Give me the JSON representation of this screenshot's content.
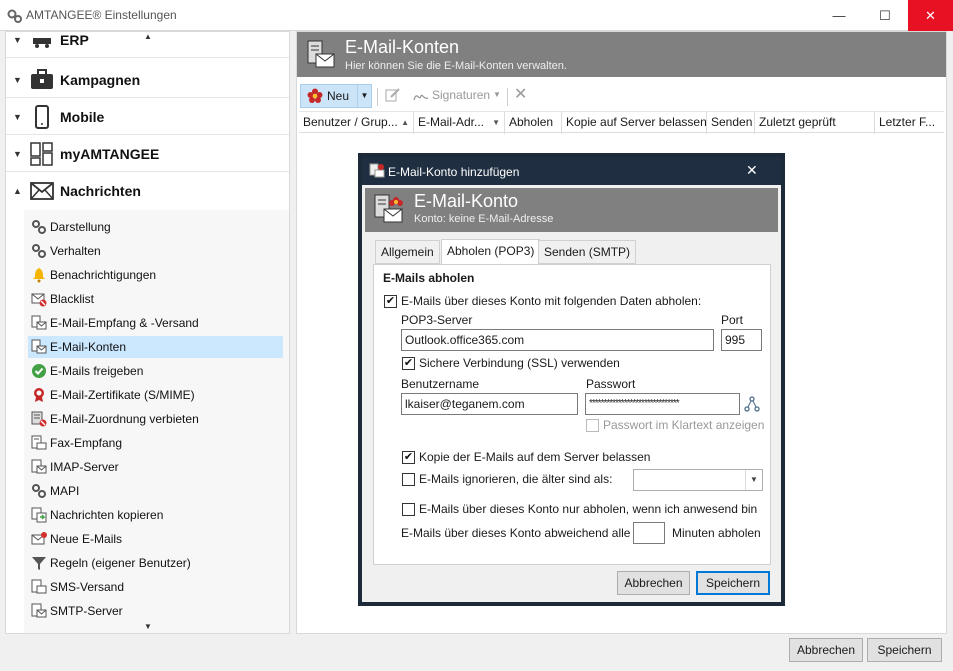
{
  "window": {
    "title": "AMTANGEE® Einstellungen",
    "minimize": "—",
    "maximize": "☐",
    "close": "✕"
  },
  "sidebar": {
    "categories": [
      {
        "label": "ERP",
        "icon": "erp-icon",
        "expanded": false
      },
      {
        "label": "Kampagnen",
        "icon": "briefcase-icon",
        "expanded": false
      },
      {
        "label": "Mobile",
        "icon": "mobile-icon",
        "expanded": false
      },
      {
        "label": "myAMTANGEE",
        "icon": "grid-icon",
        "expanded": false
      },
      {
        "label": "Nachrichten",
        "icon": "envelope-icon",
        "expanded": true
      }
    ],
    "items": [
      {
        "label": "Darstellung",
        "icon": "gears-icon"
      },
      {
        "label": "Verhalten",
        "icon": "gears-icon"
      },
      {
        "label": "Benachrichtigungen",
        "icon": "bell-icon"
      },
      {
        "label": "Blacklist",
        "icon": "blacklist-icon"
      },
      {
        "label": "E-Mail-Empfang & -Versand",
        "icon": "mail-doc-icon"
      },
      {
        "label": "E-Mail-Konten",
        "icon": "mail-accounts-icon"
      },
      {
        "label": "E-Mails freigeben",
        "icon": "checkmark-circle-icon"
      },
      {
        "label": "E-Mail-Zertifikate (S/MIME)",
        "icon": "certificate-icon"
      },
      {
        "label": "E-Mail-Zuordnung verbieten",
        "icon": "forbid-icon"
      },
      {
        "label": "Fax-Empfang",
        "icon": "fax-icon"
      },
      {
        "label": "IMAP-Server",
        "icon": "server-icon"
      },
      {
        "label": "MAPI",
        "icon": "mapi-icon"
      },
      {
        "label": "Nachrichten kopieren",
        "icon": "copy-icon"
      },
      {
        "label": "Neue E-Mails",
        "icon": "new-mail-icon"
      },
      {
        "label": "Regeln (eigener Benutzer)",
        "icon": "filter-icon"
      },
      {
        "label": "SMS-Versand",
        "icon": "sms-icon"
      },
      {
        "label": "SMTP-Server",
        "icon": "smtp-icon"
      }
    ],
    "selected_index": 5
  },
  "main": {
    "title": "E-Mail-Konten",
    "subtitle": "Hier können Sie die E-Mail-Konten verwalten.",
    "toolbar": {
      "new_label": "Neu",
      "signatures_label": "Signaturen"
    },
    "columns": [
      "Benutzer / Grup...",
      "E-Mail-Adr...",
      "Abholen",
      "Kopie auf Server belassen",
      "Senden",
      "Zuletzt geprüft",
      "Letzter F..."
    ]
  },
  "footer": {
    "cancel_label": "Abbrechen",
    "save_label": "Speichern"
  },
  "dialog": {
    "window_title": "E-Mail-Konto hinzufügen",
    "header_title": "E-Mail-Konto",
    "header_subtitle": "Konto: keine E-Mail-Adresse",
    "tabs": [
      "Allgemein",
      "Abholen (POP3)",
      "Senden (SMTP)"
    ],
    "active_tab": 1,
    "section_title": "E-Mails abholen",
    "fetch_checkbox_label": "E-Mails über dieses Konto mit folgenden Daten abholen:",
    "fetch_checked": true,
    "pop3_label": "POP3-Server",
    "pop3_value": "Outlook.office365.com",
    "port_label": "Port",
    "port_value": "995",
    "ssl_label": "Sichere Verbindung (SSL) verwenden",
    "ssl_checked": true,
    "username_label": "Benutzername",
    "username_value": "lkaiser@teganem.com",
    "password_label": "Passwort",
    "password_value": "*******************************",
    "show_plain_label": "Passwort im Klartext anzeigen",
    "show_plain_checked": false,
    "copy_label": "Kopie der E-Mails auf dem Server belassen",
    "copy_checked": true,
    "ignore_label": "E-Mails ignorieren, die älter sind als:",
    "ignore_checked": false,
    "ignore_select_value": "",
    "only_present_label": "E-Mails über dieses Konto nur abholen, wenn ich anwesend bin",
    "only_present_checked": false,
    "interval_prefix": "E-Mails über dieses Konto abweichend alle",
    "interval_value": "",
    "interval_suffix": "Minuten abholen",
    "cancel_label": "Abbrechen",
    "save_label": "Speichern"
  }
}
